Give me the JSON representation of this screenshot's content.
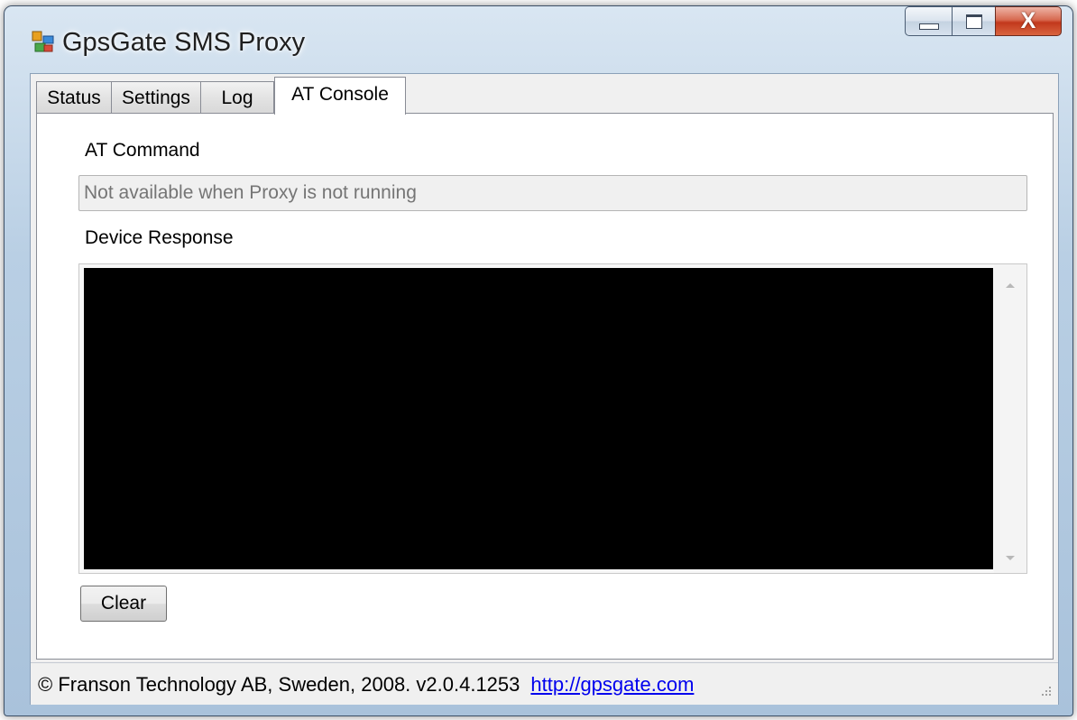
{
  "window": {
    "title": "GpsGate SMS Proxy",
    "icon": "app-icon"
  },
  "caption_buttons": {
    "minimize_icon": "minimize-icon",
    "maximize_icon": "maximize-icon",
    "close_icon": "close-icon",
    "close_glyph": "X"
  },
  "tabs": [
    {
      "label": "Status",
      "selected": false
    },
    {
      "label": "Settings",
      "selected": false
    },
    {
      "label": "Log",
      "selected": false
    },
    {
      "label": "AT Console",
      "selected": true
    }
  ],
  "at_console": {
    "at_command_label": "AT Command",
    "at_command_placeholder": "Not available when Proxy is not running",
    "at_command_value": "",
    "device_response_label": "Device Response",
    "device_response_text": "",
    "clear_button": "Clear"
  },
  "status_bar": {
    "copyright": "© Franson Technology AB, Sweden, 2008.  v2.0.4.1253",
    "link": "http://gpsgate.com"
  },
  "colors": {
    "console_background": "#000000",
    "link": "#0000ee",
    "close_button": "#c2381c"
  }
}
